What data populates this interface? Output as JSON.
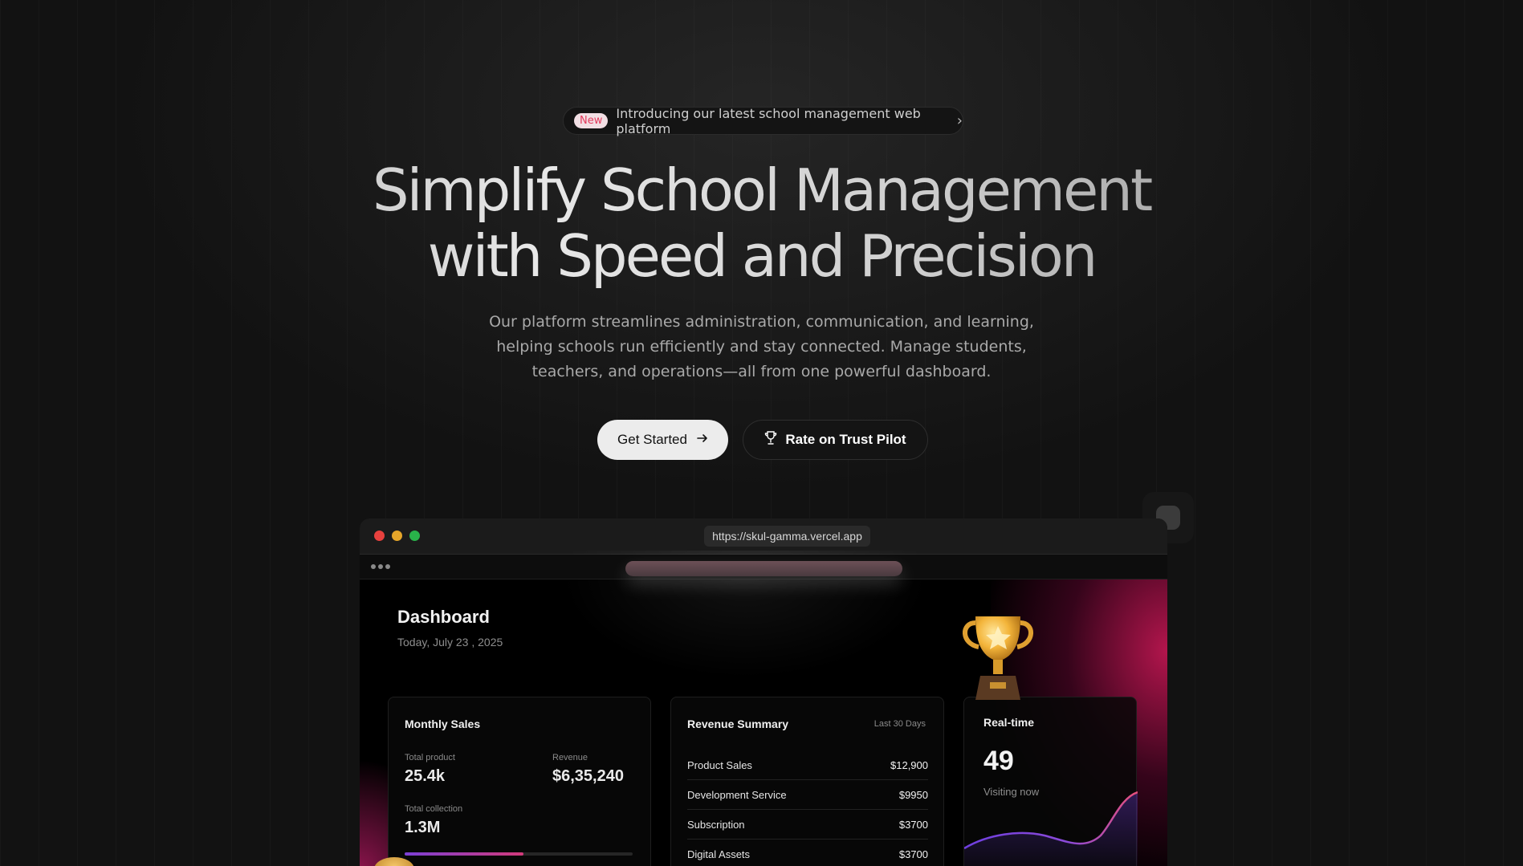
{
  "announcement": {
    "badge": "New",
    "text": "Introducing our latest school management web platform",
    "icon": "chevron-right-icon"
  },
  "hero": {
    "headline_line1": "Simplify School Management",
    "headline_line2": "with Speed and Precision",
    "subtext": "Our platform streamlines administration, communication, and learning, helping schools run efficiently and stay connected. Manage students, teachers, and operations—all from one powerful dashboard."
  },
  "cta": {
    "primary_label": "Get Started",
    "primary_icon": "arrow-right-icon",
    "secondary_label": "Rate on Trust Pilot",
    "secondary_icon": "trophy-icon"
  },
  "browser": {
    "url": "https://skul-gamma.vercel.app",
    "window_controls": [
      "close",
      "minimize",
      "maximize"
    ]
  },
  "dashboard": {
    "title": "Dashboard",
    "date": "Today,  July 23 , 2025",
    "monthly_sales": {
      "title": "Monthly Sales",
      "total_product_label": "Total product",
      "total_product_value": "25.4k",
      "revenue_label": "Revenue",
      "revenue_value": "$6,35,240",
      "total_collection_label": "Total collection",
      "total_collection_value": "1.3M",
      "progress_fraction": 0.52
    },
    "revenue_summary": {
      "title": "Revenue Summary",
      "range": "Last 30 Days",
      "rows": [
        {
          "name": "Product Sales",
          "amount": "$12,900"
        },
        {
          "name": "Development Service",
          "amount": "$9950"
        },
        {
          "name": "Subscription",
          "amount": "$3700"
        },
        {
          "name": "Digital Assets",
          "amount": "$3700"
        }
      ]
    },
    "realtime": {
      "title": "Real-time",
      "value": "49",
      "caption": "Visiting now"
    }
  },
  "colors": {
    "background": "#121212",
    "accent_pink": "#e33a5c",
    "accent_purple": "#7b3fd6",
    "button_light": "#ececec"
  }
}
